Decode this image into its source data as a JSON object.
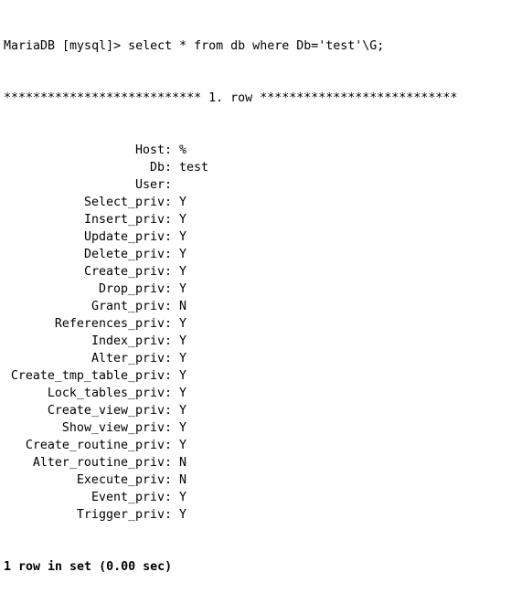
{
  "terminal": {
    "prompt": "MariaDB [mysql]> ",
    "command": "select * from db where Db='test'\\G;",
    "row_separator": "*************************** 1. row ***************************",
    "fields": [
      {
        "name": "Host",
        "value": "%"
      },
      {
        "name": "Db",
        "value": "test"
      },
      {
        "name": "User",
        "value": ""
      },
      {
        "name": "Select_priv",
        "value": "Y"
      },
      {
        "name": "Insert_priv",
        "value": "Y"
      },
      {
        "name": "Update_priv",
        "value": "Y"
      },
      {
        "name": "Delete_priv",
        "value": "Y"
      },
      {
        "name": "Create_priv",
        "value": "Y"
      },
      {
        "name": "Drop_priv",
        "value": "Y"
      },
      {
        "name": "Grant_priv",
        "value": "N"
      },
      {
        "name": "References_priv",
        "value": "Y"
      },
      {
        "name": "Index_priv",
        "value": "Y"
      },
      {
        "name": "Alter_priv",
        "value": "Y"
      },
      {
        "name": "Create_tmp_table_priv",
        "value": "Y"
      },
      {
        "name": "Lock_tables_priv",
        "value": "Y"
      },
      {
        "name": "Create_view_priv",
        "value": "Y"
      },
      {
        "name": "Show_view_priv",
        "value": "Y"
      },
      {
        "name": "Create_routine_priv",
        "value": "Y"
      },
      {
        "name": "Alter_routine_priv",
        "value": "N"
      },
      {
        "name": "Execute_priv",
        "value": "N"
      },
      {
        "name": "Event_priv",
        "value": "Y"
      },
      {
        "name": "Trigger_priv",
        "value": "Y"
      }
    ],
    "summary": "1 row in set (0.00 sec)"
  }
}
